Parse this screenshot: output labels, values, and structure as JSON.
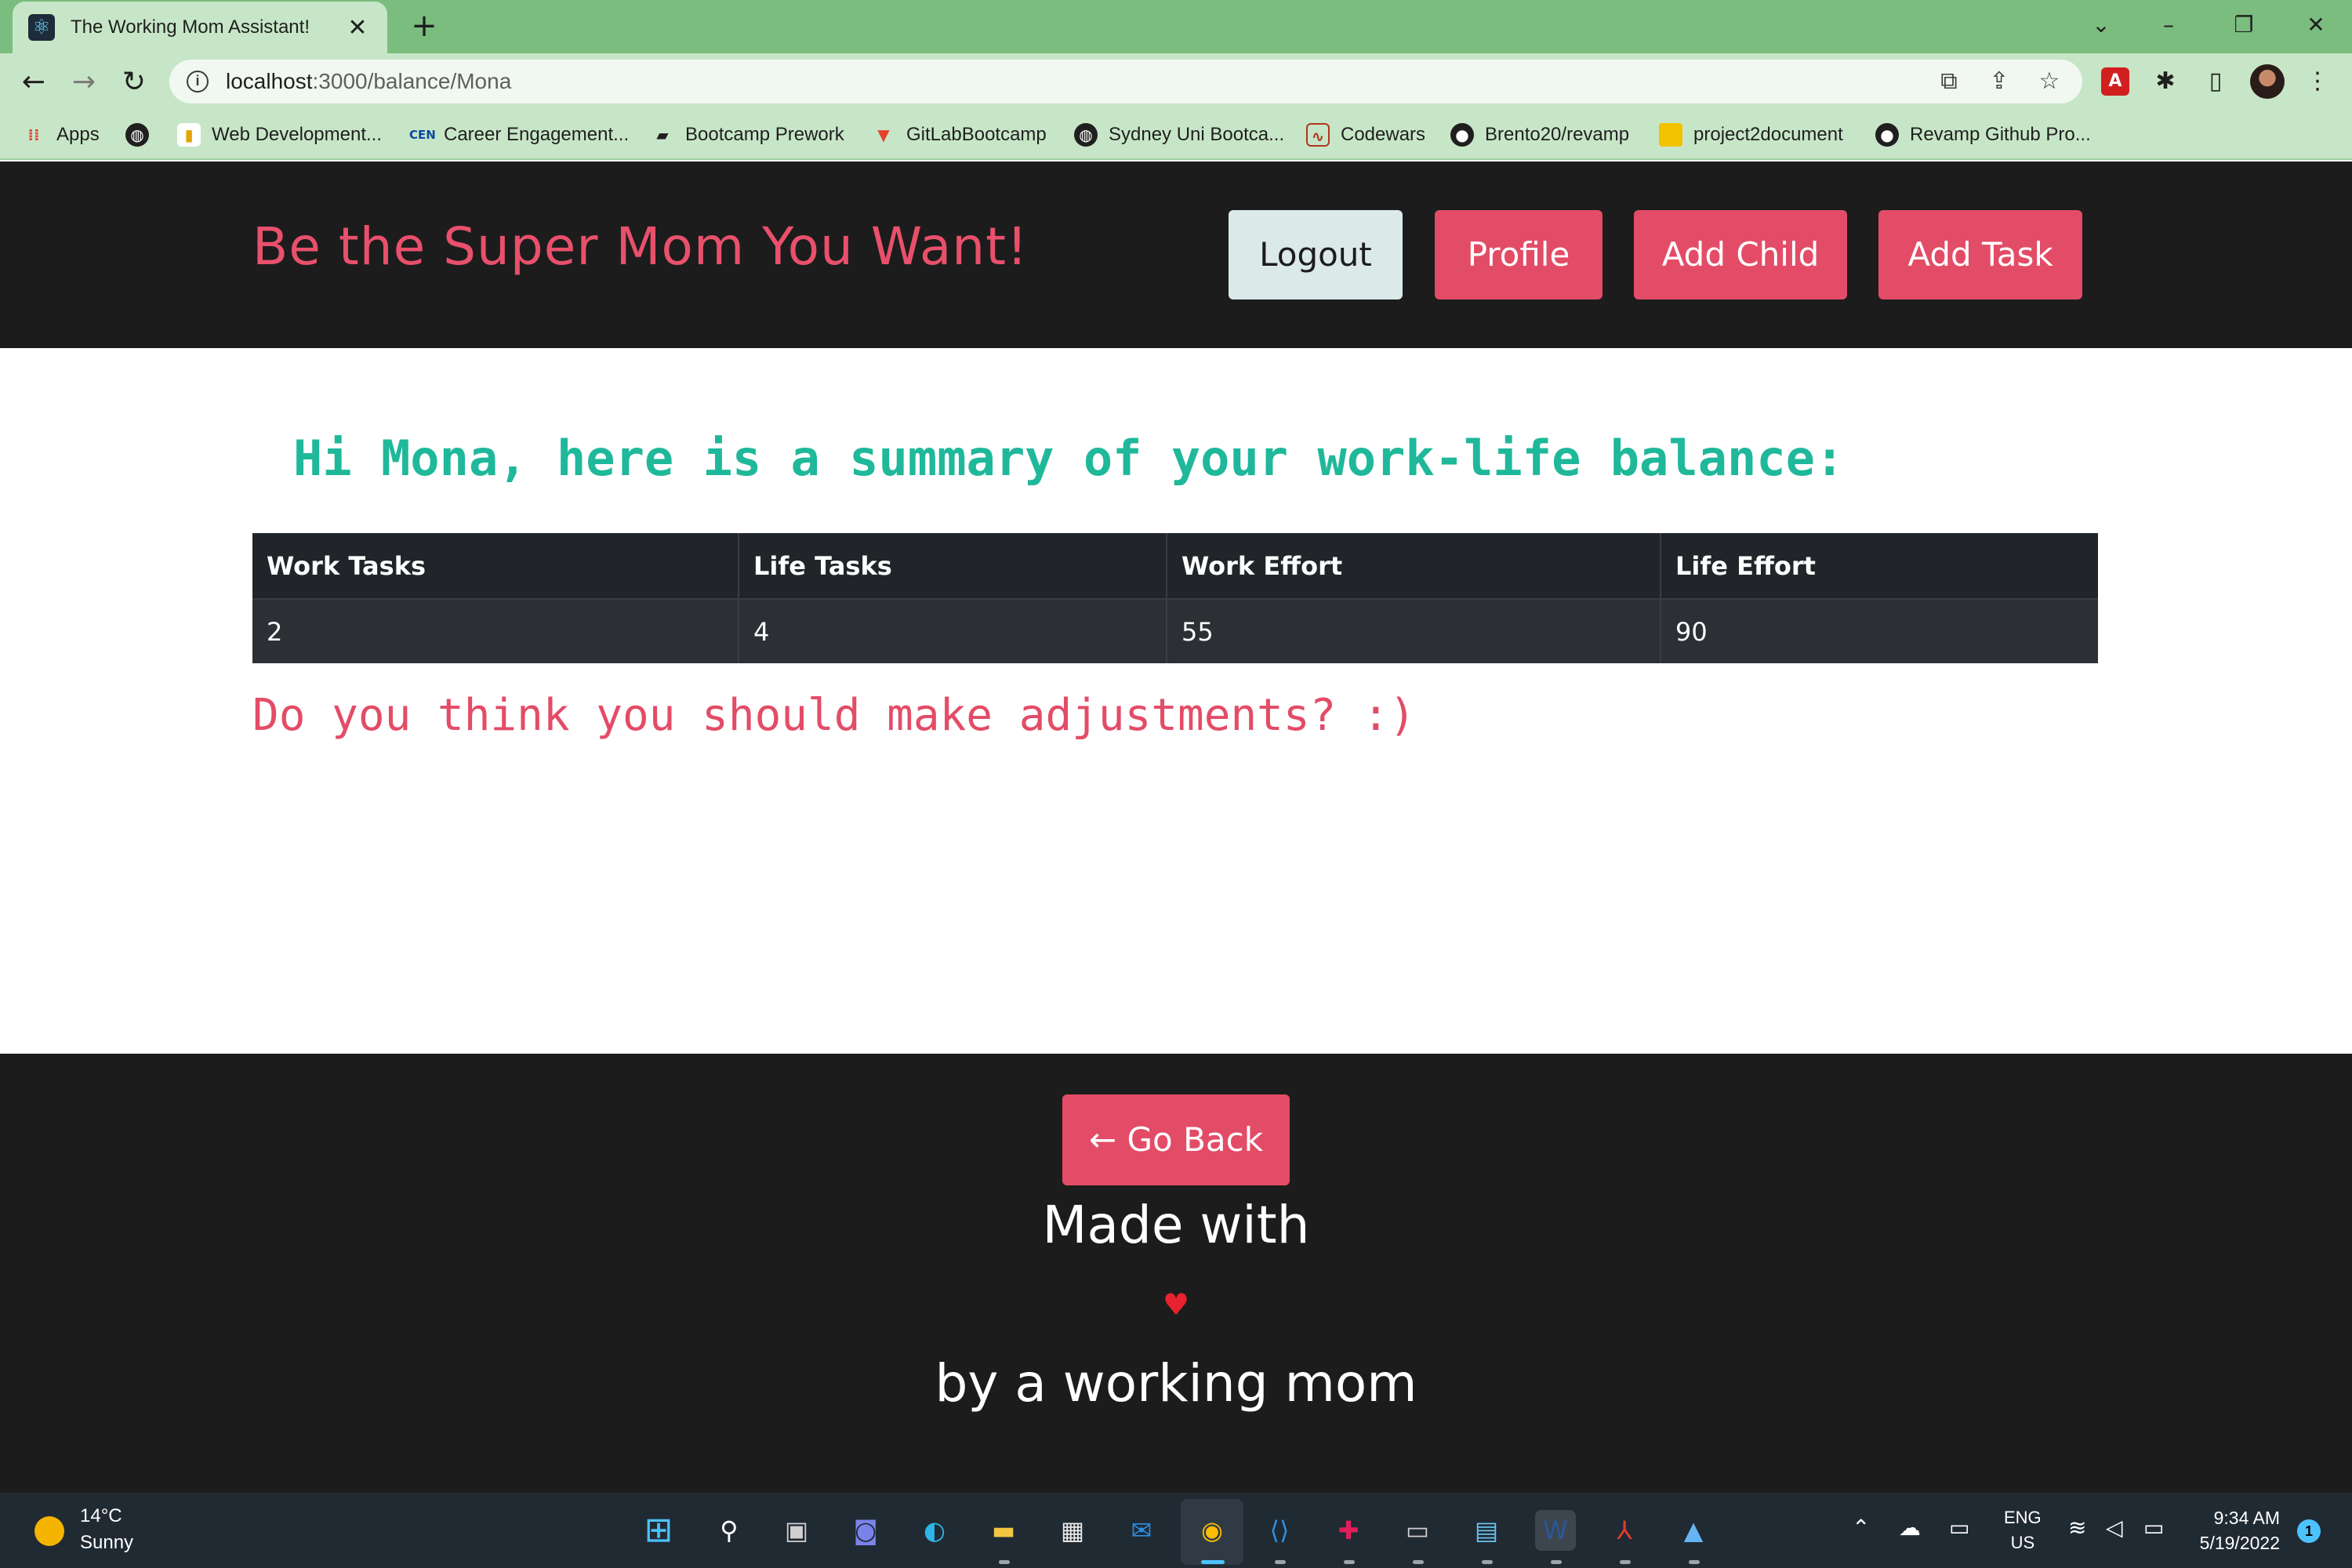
{
  "browser": {
    "tab_title": "The Working Mom Assistant!",
    "url_host": "localhost",
    "url_path": ":3000/balance/Mona",
    "bookmarks": [
      {
        "label": "Apps",
        "icon": "apps-grid-icon"
      },
      {
        "label": "",
        "icon": "globe-icon"
      },
      {
        "label": "Web Development...",
        "icon": "bookmark-icon"
      },
      {
        "label": "Career Engagement...",
        "icon": "cen-icon"
      },
      {
        "label": "Bootcamp Prework",
        "icon": "book-icon"
      },
      {
        "label": "GitLabBootcamp",
        "icon": "gitlab-icon"
      },
      {
        "label": "Sydney Uni Bootca...",
        "icon": "globe-icon"
      },
      {
        "label": "Codewars",
        "icon": "codewars-icon"
      },
      {
        "label": "Brento20/revamp",
        "icon": "github-icon"
      },
      {
        "label": "project2document",
        "icon": "folder-icon"
      },
      {
        "label": "Revamp Github Pro...",
        "icon": "github-icon"
      }
    ]
  },
  "header": {
    "brand": "Be the Super Mom You Want!",
    "buttons": {
      "logout": "Logout",
      "profile": "Profile",
      "add_child": "Add Child",
      "add_task": "Add Task"
    }
  },
  "main": {
    "greeting": "Hi Mona, here is a summary of your work-life balance:",
    "table": {
      "headers": [
        "Work Tasks",
        "Life Tasks",
        "Work Effort",
        "Life Effort"
      ],
      "row": [
        "2",
        "4",
        "55",
        "90"
      ]
    },
    "question": "Do you think you should make adjustments? :)"
  },
  "footer": {
    "go_back": "← Go Back",
    "made_with": "Made with",
    "heart": "♥",
    "by": "by a working mom"
  },
  "taskbar": {
    "temperature": "14°C",
    "condition": "Sunny",
    "lang_top": "ENG",
    "lang_bottom": "US",
    "time": "9:34 AM",
    "date": "5/19/2022",
    "notifications": "1"
  },
  "colors": {
    "accent": "#e34c67",
    "greeting": "#1fb89a",
    "dark_bg": "#1c1c1c",
    "chrome_green": "#7bbd7f"
  }
}
